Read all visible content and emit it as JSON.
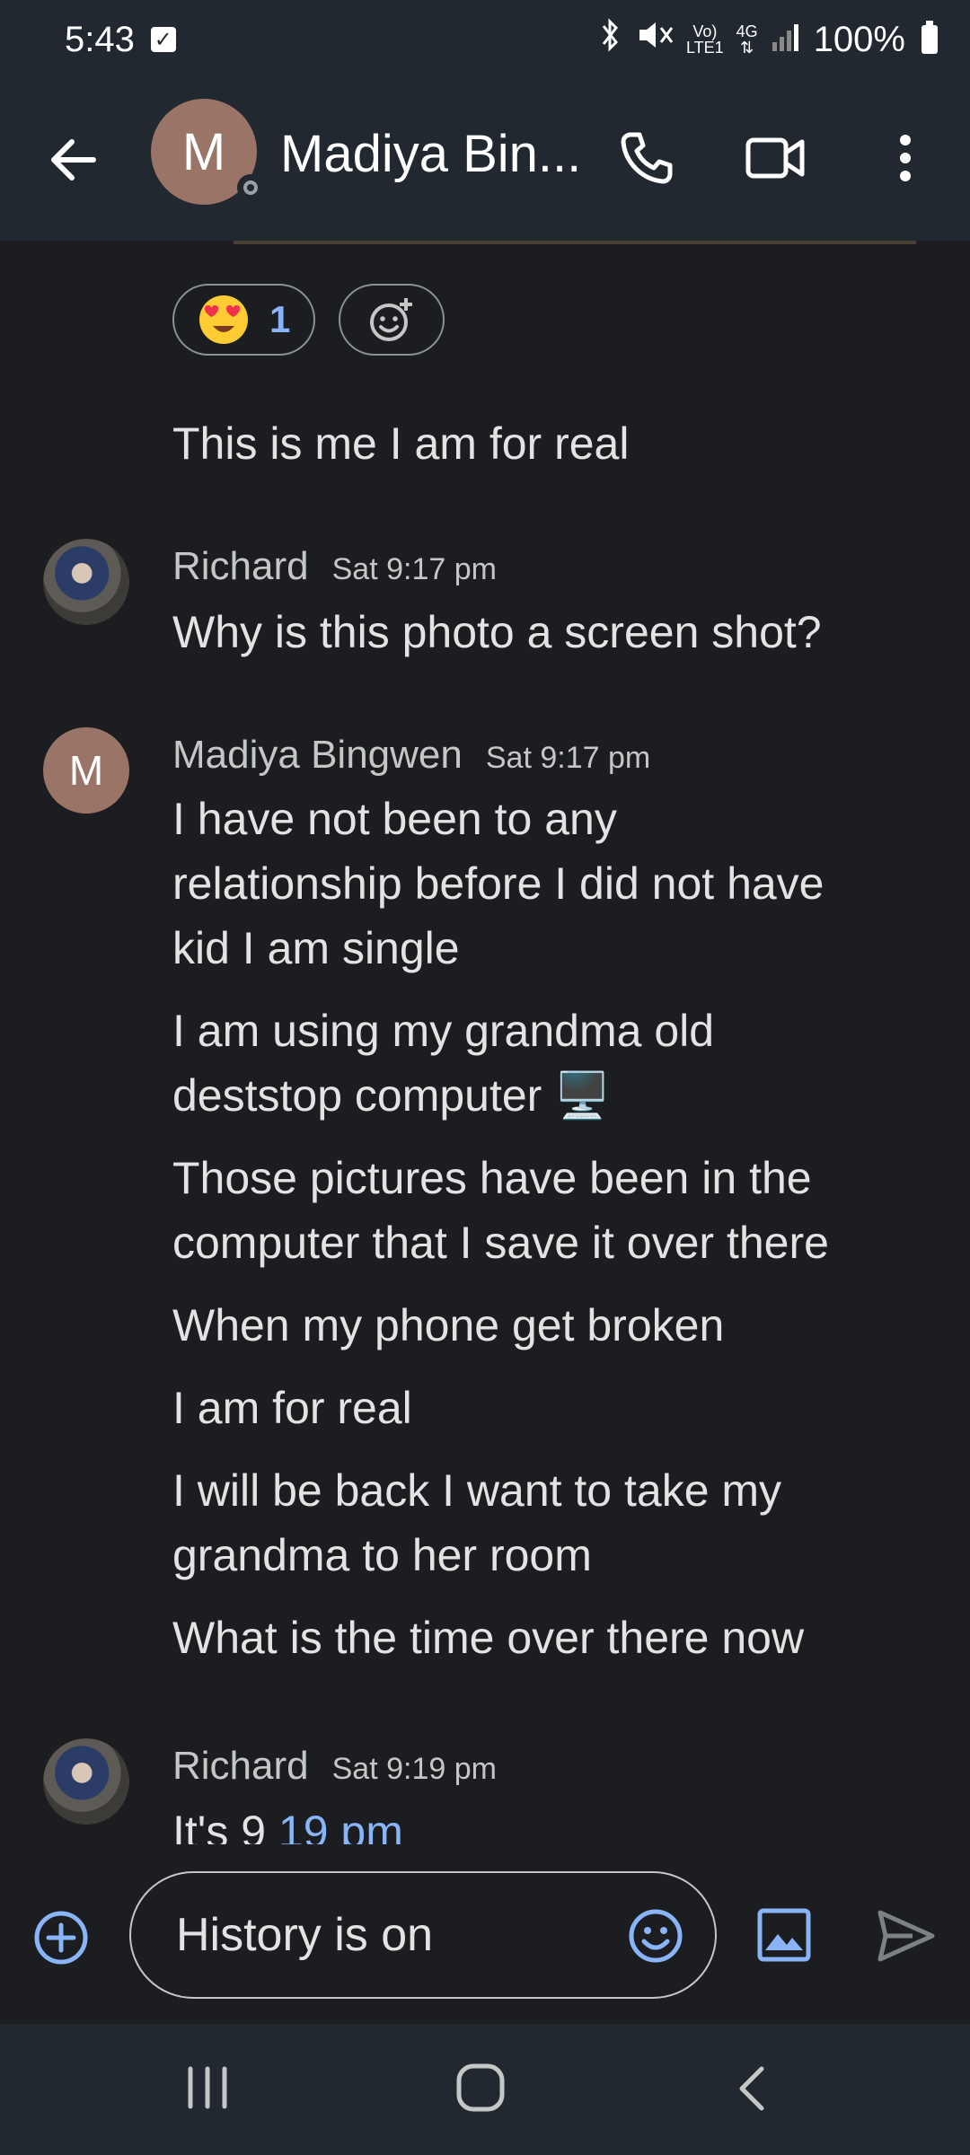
{
  "status_bar": {
    "time": "5:43",
    "net_top": "Vo)",
    "net_bottom": "LTE1",
    "gen": "4G",
    "battery": "100%"
  },
  "app_bar": {
    "avatar_letter": "M",
    "contact_name": "Madiya Bin..."
  },
  "reactions": {
    "love_count": "1"
  },
  "messages": {
    "m0": "This is me I am for real",
    "richard1_name": "Richard",
    "richard1_time": "Sat 9:17 pm",
    "richard1_text": "Why is this photo a screen shot?",
    "madiya_avatar": "M",
    "madiya_name": "Madiya Bingwen",
    "madiya_time": "Sat 9:17 pm",
    "m1_l1": "I have not been to any",
    "m1_l2": "relationship before I did not have",
    "m1_l3": "kid I am single",
    "m2_l1": "I am using my grandma old",
    "m2_l2": "deststop computer 🖥️",
    "m3_l1": "Those pictures have been in the",
    "m3_l2": "computer that I save it over there",
    "m4": "When my phone get broken",
    "m5": "I am for real",
    "m6_l1": "I will be back I want to take my",
    "m6_l2": "grandma to her room",
    "m7": "What is the time over there now",
    "richard2_name": "Richard",
    "richard2_time": "Sat 9:19 pm",
    "richard2_prefix": "It's 9 ",
    "richard2_link": "19 pm"
  },
  "composer": {
    "placeholder": "History is on"
  },
  "colors": {
    "accent": "#8ab4f8",
    "background": "#1b1d20",
    "bar": "#222830"
  }
}
